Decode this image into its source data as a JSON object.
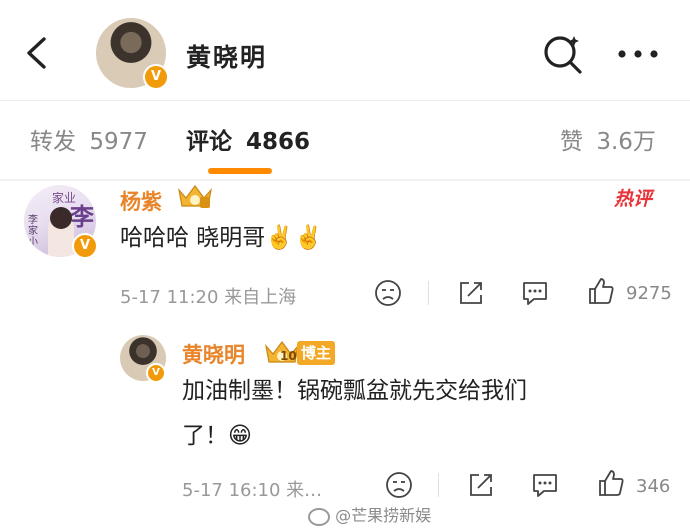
{
  "header": {
    "title": "黄晓明",
    "back_icon": "chevron-left-icon",
    "search_icon": "search-icon",
    "more_icon": "more-horizontal-icon",
    "verified_badge": "V"
  },
  "tabs": [
    {
      "label": "转发",
      "count": "5977",
      "active": false
    },
    {
      "label": "评论",
      "count": "4866",
      "active": true
    },
    {
      "label": "赞",
      "count": "3.6万",
      "active": false
    }
  ],
  "comments": [
    {
      "user": "杨紫",
      "badge": "V",
      "hot_tag": "热评",
      "text": "哈哈哈 晓明哥✌️✌️",
      "meta": "5-17 11:20 来自上海",
      "like_count": "9275",
      "avatar_text_top": "家业",
      "avatar_text_side": "李家小房",
      "avatar_text_big": "李"
    }
  ],
  "reply": {
    "user": "黄晓明",
    "author_tag": "博主",
    "level": "10",
    "badge": "V",
    "text_line1": "加油制墨！锅碗瓢盆就先交给我们",
    "text_line2": "了！😁",
    "meta": "5-17 16:10 来…",
    "like_count": "346"
  },
  "watermark": "@芒果捞新娱",
  "colors": {
    "accent": "#ff8a00",
    "name": "#e8852b",
    "hot": "#e8343a",
    "badge": "#f29b0a"
  }
}
